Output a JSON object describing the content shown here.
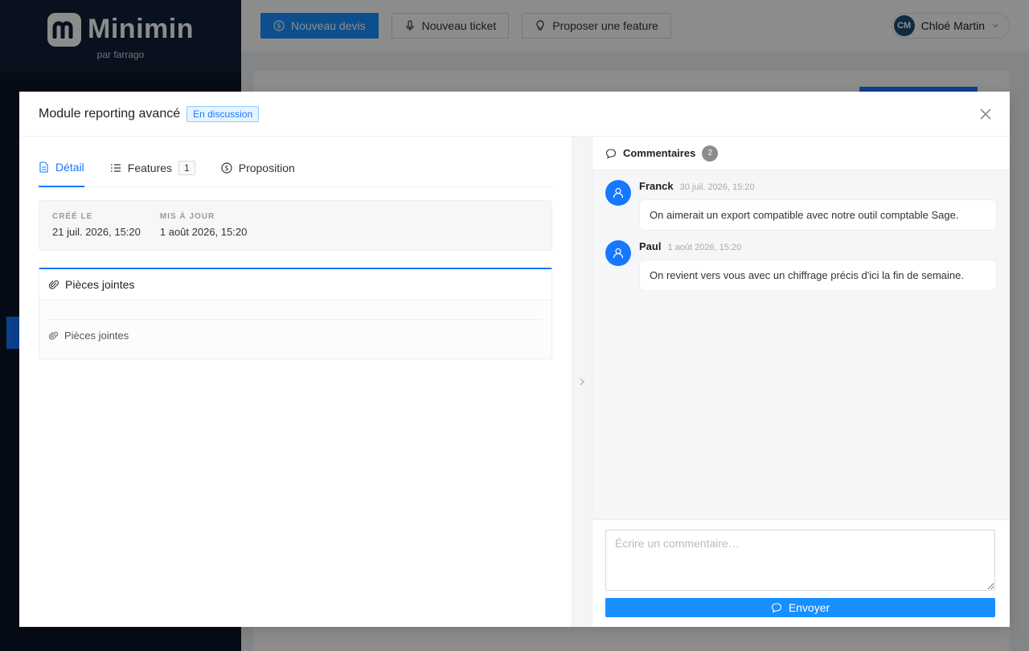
{
  "brand": {
    "name": "Minimin",
    "subtitle": "par farrago"
  },
  "topbar": {
    "new_quote_label": "Nouveau devis",
    "new_ticket_label": "Nouveau ticket",
    "propose_feature_label": "Proposer une feature",
    "user_initials": "CM",
    "user_name": "Chloé Martin"
  },
  "modal": {
    "title": "Module reporting avancé",
    "status": "En discussion",
    "tabs": [
      {
        "label": "Détail"
      },
      {
        "label": "Features",
        "count": "1"
      },
      {
        "label": "Proposition"
      }
    ],
    "meta": {
      "created_label": "CRÉÉ LE",
      "created_value": "21 juil. 2026, 15:20",
      "updated_label": "MIS À JOUR",
      "updated_value": "1 août 2026, 15:20"
    },
    "attachments": {
      "title": "Pièces jointes",
      "item": "Pièces jointes"
    }
  },
  "comments": {
    "title": "Commentaires",
    "count": "2",
    "items": [
      {
        "author": "Franck",
        "time": "30 juil. 2026, 15:20",
        "text": "On aimerait un export compatible avec notre outil comptable Sage."
      },
      {
        "author": "Paul",
        "time": "1 août 2026, 15:20",
        "text": "On revient vers vous avec un chiffrage précis d'ici la fin de semaine."
      }
    ],
    "placeholder": "Écrire un commentaire…",
    "send_label": "Envoyer"
  },
  "colors": {
    "primary": "#1890ff",
    "sidebar": "#0b1728"
  }
}
